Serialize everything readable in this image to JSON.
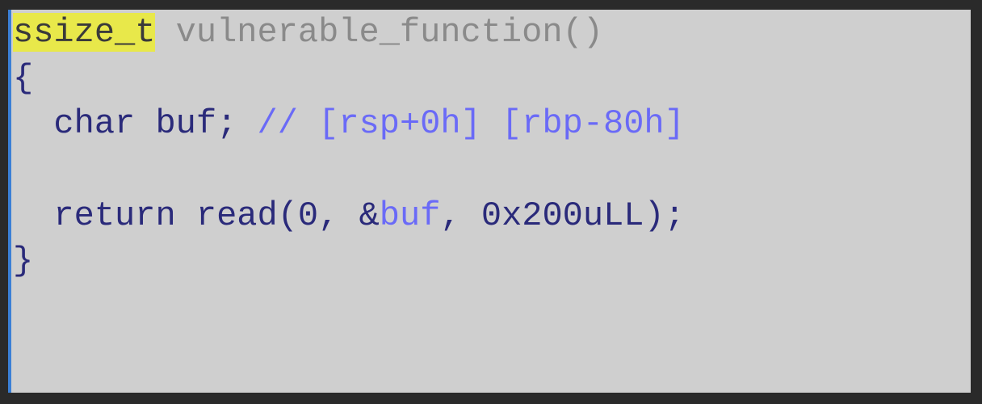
{
  "code": {
    "line1": {
      "type": "ssize_t",
      "func": "vulnerable_function",
      "parens": "()"
    },
    "line2": {
      "brace": "{"
    },
    "line3": {
      "indent": "  ",
      "type": "char",
      "space1": " ",
      "var": "buf",
      "semi": ";",
      "space2": " ",
      "comment": "// [rsp+0h] [rbp-80h]"
    },
    "line4": {
      "blank": ""
    },
    "line5": {
      "indent": "  ",
      "keyword": "return",
      "space1": " ",
      "call": "read",
      "open": "(",
      "arg1": "0",
      "comma1": ",",
      "space2": " ",
      "amp": "&",
      "ref": "buf",
      "comma2": ",",
      "space3": " ",
      "arg3": "0x200uLL",
      "close": ")",
      "semi": ";"
    },
    "line6": {
      "brace": "}"
    }
  }
}
